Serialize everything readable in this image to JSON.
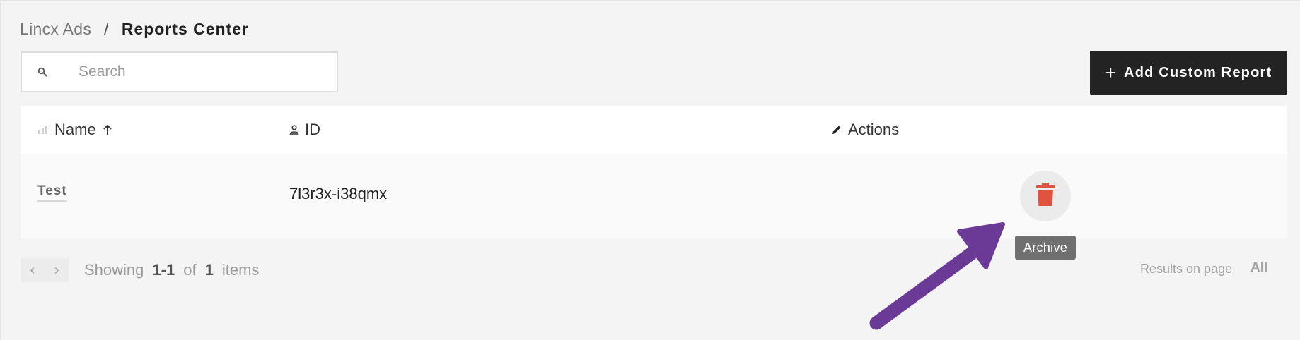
{
  "breadcrumb": {
    "root": "Lincx Ads",
    "separator": "/",
    "current": "Reports Center"
  },
  "search": {
    "placeholder": "Search",
    "value": "",
    "icon": "search-icon"
  },
  "toolbar": {
    "add_icon": "+",
    "add_label": "Add Custom Report"
  },
  "table": {
    "columns": [
      {
        "label": "Name",
        "icon": "chart-icon",
        "sort": "ascending"
      },
      {
        "label": "ID",
        "icon": "person-icon"
      },
      {
        "label": "Actions",
        "icon": "pencil-icon"
      }
    ],
    "rows": [
      {
        "name": "Test",
        "id": "7l3r3x-i38qmx",
        "action_icon": "trash-icon"
      }
    ]
  },
  "tooltip": {
    "text": "Archive"
  },
  "pagination": {
    "prev": "‹",
    "next": "›",
    "showing_label": "Showing",
    "range_start": "1",
    "range_sep": "-",
    "range_end": "1",
    "of_label": "of",
    "total": "1",
    "items_label": "items",
    "results_label": "Results on page",
    "results_value": "All"
  },
  "colors": {
    "accent_button": "#232323",
    "delete_red": "#e0533f",
    "annotation_arrow": "#6b3a96",
    "tooltip_bg": "#6f6f6f"
  }
}
